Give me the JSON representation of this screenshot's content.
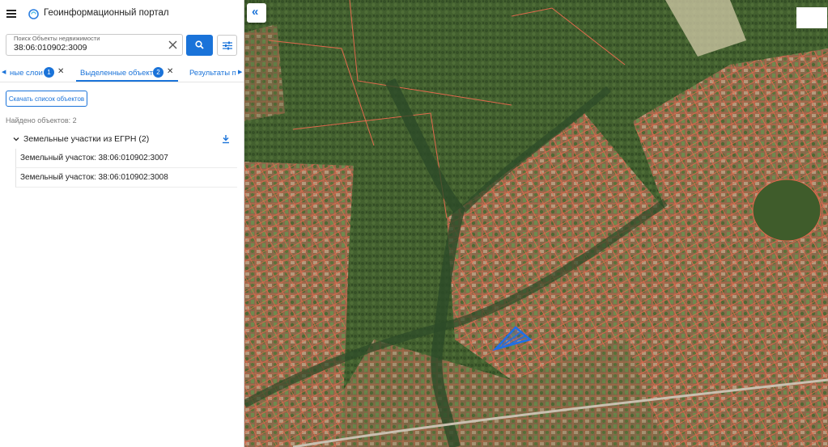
{
  "app": {
    "title": "Геоинформационный портал"
  },
  "search": {
    "label": "Поиск Объекты недвижимости",
    "value": "38:06:010902:3009"
  },
  "tabs": [
    {
      "label": "ные слои",
      "badge": "1",
      "active": false
    },
    {
      "label": "Выделенные объекты",
      "badge": "2",
      "active": true
    },
    {
      "label": "Результаты п",
      "active": false
    }
  ],
  "actions": {
    "download_list_label": "Скачать список объектов"
  },
  "found": {
    "text": "Найдено объектов: 2"
  },
  "group": {
    "title": "Земельные участки из ЕГРН (2)",
    "items": [
      {
        "label": "Земельный участок: 38:06:010902:3007"
      },
      {
        "label": "Земельный участок: 38:06:010902:3008"
      }
    ]
  },
  "map": {
    "collapse_icon": "«"
  },
  "colors": {
    "accent": "#1a73d9",
    "parcel_border": "#e2694d",
    "selected_parcel": "#1f6fe6"
  }
}
